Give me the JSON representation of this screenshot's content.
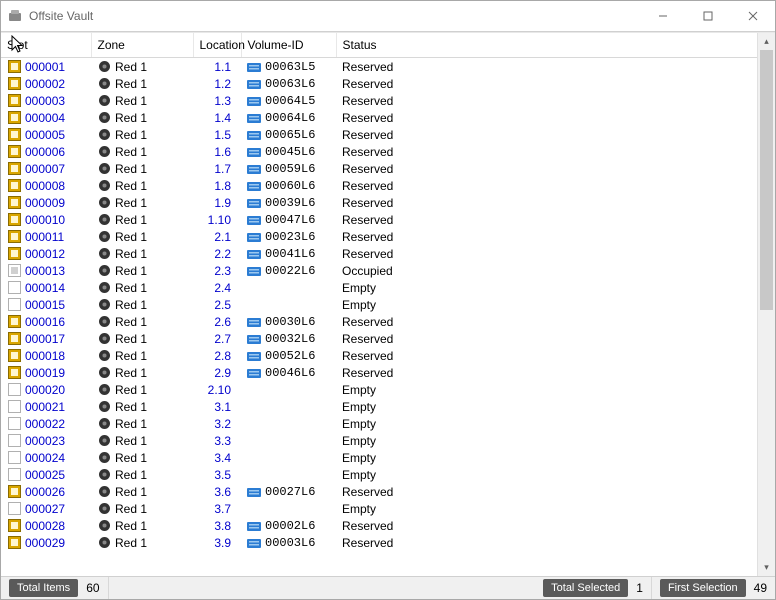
{
  "window": {
    "title": "Offsite Vault"
  },
  "columns": {
    "slot": "Slot",
    "zone": "Zone",
    "location": "Location",
    "volume": "Volume-ID",
    "status": "Status"
  },
  "rows": [
    {
      "slot": "000001",
      "slot_icon": "reserved",
      "zone": "Red 1",
      "loc": "1.1",
      "vol": "00063L5",
      "vol_icon": true,
      "status": "Reserved"
    },
    {
      "slot": "000002",
      "slot_icon": "reserved",
      "zone": "Red 1",
      "loc": "1.2",
      "vol": "00063L6",
      "vol_icon": true,
      "status": "Reserved"
    },
    {
      "slot": "000003",
      "slot_icon": "reserved",
      "zone": "Red 1",
      "loc": "1.3",
      "vol": "00064L5",
      "vol_icon": true,
      "status": "Reserved"
    },
    {
      "slot": "000004",
      "slot_icon": "reserved",
      "zone": "Red 1",
      "loc": "1.4",
      "vol": "00064L6",
      "vol_icon": true,
      "status": "Reserved"
    },
    {
      "slot": "000005",
      "slot_icon": "reserved",
      "zone": "Red 1",
      "loc": "1.5",
      "vol": "00065L6",
      "vol_icon": true,
      "status": "Reserved"
    },
    {
      "slot": "000006",
      "slot_icon": "reserved",
      "zone": "Red 1",
      "loc": "1.6",
      "vol": "00045L6",
      "vol_icon": true,
      "status": "Reserved"
    },
    {
      "slot": "000007",
      "slot_icon": "reserved",
      "zone": "Red 1",
      "loc": "1.7",
      "vol": "00059L6",
      "vol_icon": true,
      "status": "Reserved"
    },
    {
      "slot": "000008",
      "slot_icon": "reserved",
      "zone": "Red 1",
      "loc": "1.8",
      "vol": "00060L6",
      "vol_icon": true,
      "status": "Reserved"
    },
    {
      "slot": "000009",
      "slot_icon": "reserved",
      "zone": "Red 1",
      "loc": "1.9",
      "vol": "00039L6",
      "vol_icon": true,
      "status": "Reserved"
    },
    {
      "slot": "000010",
      "slot_icon": "reserved",
      "zone": "Red 1",
      "loc": "1.10",
      "vol": "00047L6",
      "vol_icon": true,
      "status": "Reserved"
    },
    {
      "slot": "000011",
      "slot_icon": "reserved",
      "zone": "Red 1",
      "loc": "2.1",
      "vol": "00023L6",
      "vol_icon": true,
      "status": "Reserved"
    },
    {
      "slot": "000012",
      "slot_icon": "reserved",
      "zone": "Red 1",
      "loc": "2.2",
      "vol": "00041L6",
      "vol_icon": true,
      "status": "Reserved"
    },
    {
      "slot": "000013",
      "slot_icon": "occupied",
      "zone": "Red 1",
      "loc": "2.3",
      "vol": "00022L6",
      "vol_icon": true,
      "status": "Occupied"
    },
    {
      "slot": "000014",
      "slot_icon": "empty",
      "zone": "Red 1",
      "loc": "2.4",
      "vol": "",
      "vol_icon": false,
      "status": "Empty"
    },
    {
      "slot": "000015",
      "slot_icon": "empty",
      "zone": "Red 1",
      "loc": "2.5",
      "vol": "",
      "vol_icon": false,
      "status": "Empty"
    },
    {
      "slot": "000016",
      "slot_icon": "reserved",
      "zone": "Red 1",
      "loc": "2.6",
      "vol": "00030L6",
      "vol_icon": true,
      "status": "Reserved"
    },
    {
      "slot": "000017",
      "slot_icon": "reserved",
      "zone": "Red 1",
      "loc": "2.7",
      "vol": "00032L6",
      "vol_icon": true,
      "status": "Reserved"
    },
    {
      "slot": "000018",
      "slot_icon": "reserved",
      "zone": "Red 1",
      "loc": "2.8",
      "vol": "00052L6",
      "vol_icon": true,
      "status": "Reserved"
    },
    {
      "slot": "000019",
      "slot_icon": "reserved",
      "zone": "Red 1",
      "loc": "2.9",
      "vol": "00046L6",
      "vol_icon": true,
      "status": "Reserved"
    },
    {
      "slot": "000020",
      "slot_icon": "empty",
      "zone": "Red 1",
      "loc": "2.10",
      "vol": "",
      "vol_icon": false,
      "status": "Empty"
    },
    {
      "slot": "000021",
      "slot_icon": "empty",
      "zone": "Red 1",
      "loc": "3.1",
      "vol": "",
      "vol_icon": false,
      "status": "Empty"
    },
    {
      "slot": "000022",
      "slot_icon": "empty",
      "zone": "Red 1",
      "loc": "3.2",
      "vol": "",
      "vol_icon": false,
      "status": "Empty"
    },
    {
      "slot": "000023",
      "slot_icon": "empty",
      "zone": "Red 1",
      "loc": "3.3",
      "vol": "",
      "vol_icon": false,
      "status": "Empty"
    },
    {
      "slot": "000024",
      "slot_icon": "empty",
      "zone": "Red 1",
      "loc": "3.4",
      "vol": "",
      "vol_icon": false,
      "status": "Empty"
    },
    {
      "slot": "000025",
      "slot_icon": "empty",
      "zone": "Red 1",
      "loc": "3.5",
      "vol": "",
      "vol_icon": false,
      "status": "Empty"
    },
    {
      "slot": "000026",
      "slot_icon": "reserved",
      "zone": "Red 1",
      "loc": "3.6",
      "vol": "00027L6",
      "vol_icon": true,
      "status": "Reserved"
    },
    {
      "slot": "000027",
      "slot_icon": "empty",
      "zone": "Red 1",
      "loc": "3.7",
      "vol": "",
      "vol_icon": false,
      "status": "Empty"
    },
    {
      "slot": "000028",
      "slot_icon": "reserved",
      "zone": "Red 1",
      "loc": "3.8",
      "vol": "00002L6",
      "vol_icon": true,
      "status": "Reserved"
    },
    {
      "slot": "000029",
      "slot_icon": "reserved",
      "zone": "Red 1",
      "loc": "3.9",
      "vol": "00003L6",
      "vol_icon": true,
      "status": "Reserved"
    }
  ],
  "status": {
    "total_label": "Total Items",
    "total_value": "60",
    "selected_label": "Total Selected",
    "selected_value": "1",
    "first_label": "First Selection",
    "first_value": "49"
  }
}
